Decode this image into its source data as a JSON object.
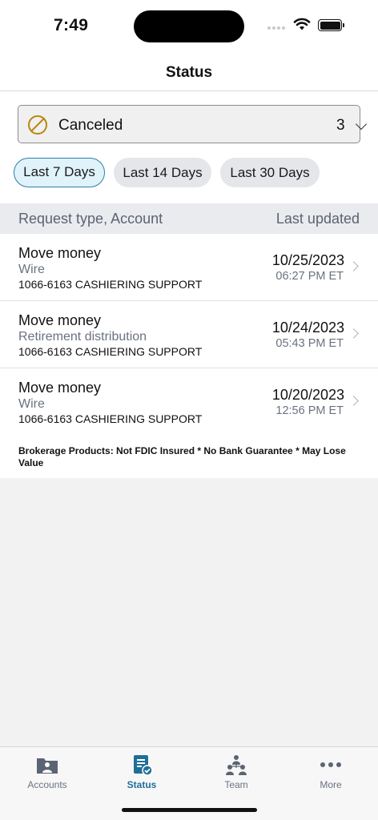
{
  "status_bar": {
    "time": "7:49"
  },
  "nav": {
    "title": "Status"
  },
  "filter": {
    "status_label": "Canceled",
    "status_count": "3",
    "chips": [
      {
        "label": "Last 7 Days",
        "selected": true
      },
      {
        "label": "Last 14 Days",
        "selected": false
      },
      {
        "label": "Last 30 Days",
        "selected": false
      }
    ]
  },
  "table_header": {
    "left": "Request type, Account",
    "right": "Last updated"
  },
  "requests": [
    {
      "type": "Move money",
      "subtype": "Wire",
      "account": "1066-6163 CASHIERING SUPPORT",
      "date": "10/25/2023",
      "time": "06:27 PM ET"
    },
    {
      "type": "Move money",
      "subtype": "Retirement distribution",
      "account": "1066-6163 CASHIERING SUPPORT",
      "date": "10/24/2023",
      "time": "05:43 PM ET"
    },
    {
      "type": "Move money",
      "subtype": "Wire",
      "account": "1066-6163 CASHIERING SUPPORT",
      "date": "10/20/2023",
      "time": "12:56 PM ET"
    }
  ],
  "disclaimer": "Brokerage Products: Not FDIC Insured * No Bank Guarantee * May Lose Value",
  "tabs": [
    {
      "label": "Accounts",
      "icon": "accounts-icon"
    },
    {
      "label": "Status",
      "icon": "status-icon"
    },
    {
      "label": "Team",
      "icon": "team-icon"
    },
    {
      "label": "More",
      "icon": "more-icon"
    }
  ],
  "colors": {
    "accent": "#1f6f97",
    "canceled": "#b8860b",
    "chip_selected_bg": "#e0f3fb",
    "icon_gray": "#5b6472"
  }
}
